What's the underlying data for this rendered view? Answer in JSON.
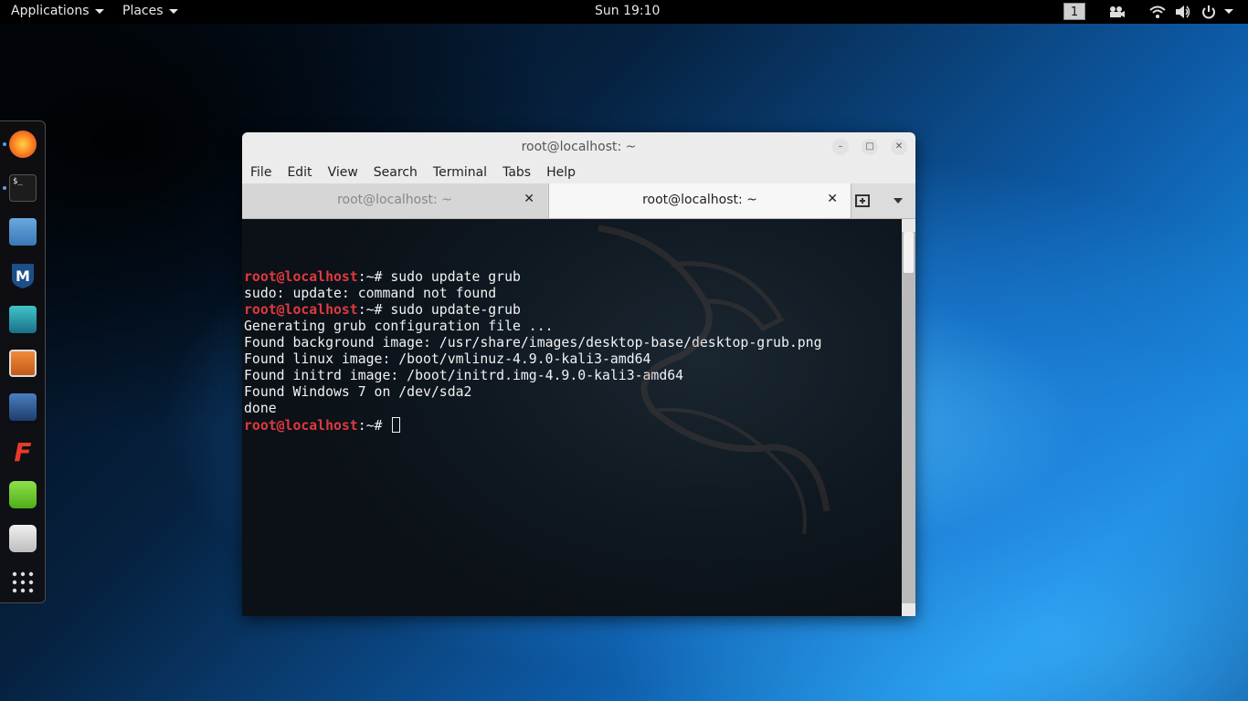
{
  "topbar": {
    "applications": "Applications",
    "places": "Places",
    "clock": "Sun 19:10",
    "workspace": "1"
  },
  "dock": {
    "items": [
      "firefox-icon",
      "terminal-icon",
      "files-icon",
      "metasploit-icon",
      "armitage-icon",
      "burpsuite-icon",
      "beef-icon",
      "faraday-icon",
      "leafpad-icon",
      "cherrytree-icon",
      "show-apps-icon"
    ]
  },
  "window": {
    "title": "root@localhost: ~",
    "menu": [
      "File",
      "Edit",
      "View",
      "Search",
      "Terminal",
      "Tabs",
      "Help"
    ],
    "tabs": [
      {
        "label": "root@localhost: ~"
      },
      {
        "label": "root@localhost: ~"
      }
    ]
  },
  "terminal": {
    "prompt": "root@localhost",
    "prompt_suffix": ":~# ",
    "lines": [
      {
        "prompt": true,
        "text": "sudo update grub"
      },
      {
        "prompt": false,
        "text": "sudo: update: command not found"
      },
      {
        "prompt": true,
        "text": "sudo update-grub"
      },
      {
        "prompt": false,
        "text": "Generating grub configuration file ..."
      },
      {
        "prompt": false,
        "text": "Found background image: /usr/share/images/desktop-base/desktop-grub.png"
      },
      {
        "prompt": false,
        "text": "Found linux image: /boot/vmlinuz-4.9.0-kali3-amd64"
      },
      {
        "prompt": false,
        "text": "Found initrd image: /boot/initrd.img-4.9.0-kali3-amd64"
      },
      {
        "prompt": false,
        "text": "Found Windows 7 on /dev/sda2"
      },
      {
        "prompt": false,
        "text": "done"
      },
      {
        "prompt": true,
        "text": ""
      }
    ]
  },
  "colors": {
    "prompt": "#e0393e",
    "terminal_bg": "#0f1820",
    "accent": "#5aa0e8"
  }
}
